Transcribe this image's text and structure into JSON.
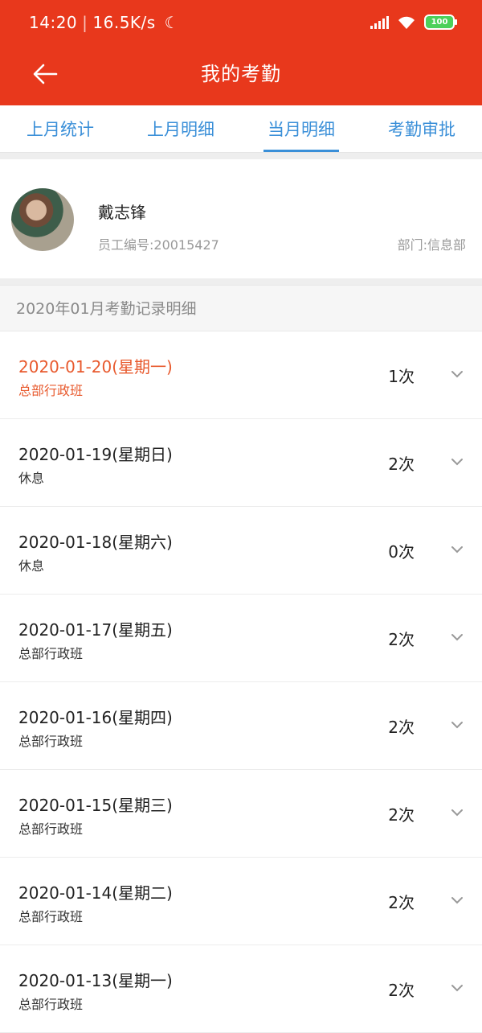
{
  "status": {
    "time": "14:20",
    "speed": "16.5K/s",
    "battery": "100"
  },
  "header": {
    "title": "我的考勤",
    "accent": "#e8381c"
  },
  "tabs": [
    {
      "label": "上月统计"
    },
    {
      "label": "上月明细"
    },
    {
      "label": "当月明细"
    },
    {
      "label": "考勤审批"
    }
  ],
  "profile": {
    "name": "戴志锋",
    "employee_no": "员工编号:20015427",
    "department": "部门:信息部"
  },
  "records": {
    "header": "2020年01月考勤记录明细",
    "items": [
      {
        "date": "2020-01-20(星期一)",
        "shift": "总部行政班",
        "count": "1次"
      },
      {
        "date": "2020-01-19(星期日)",
        "shift": "休息",
        "count": "2次"
      },
      {
        "date": "2020-01-18(星期六)",
        "shift": "休息",
        "count": "0次"
      },
      {
        "date": "2020-01-17(星期五)",
        "shift": "总部行政班",
        "count": "2次"
      },
      {
        "date": "2020-01-16(星期四)",
        "shift": "总部行政班",
        "count": "2次"
      },
      {
        "date": "2020-01-15(星期三)",
        "shift": "总部行政班",
        "count": "2次"
      },
      {
        "date": "2020-01-14(星期二)",
        "shift": "总部行政班",
        "count": "2次"
      },
      {
        "date": "2020-01-13(星期一)",
        "shift": "总部行政班",
        "count": "2次"
      }
    ]
  }
}
